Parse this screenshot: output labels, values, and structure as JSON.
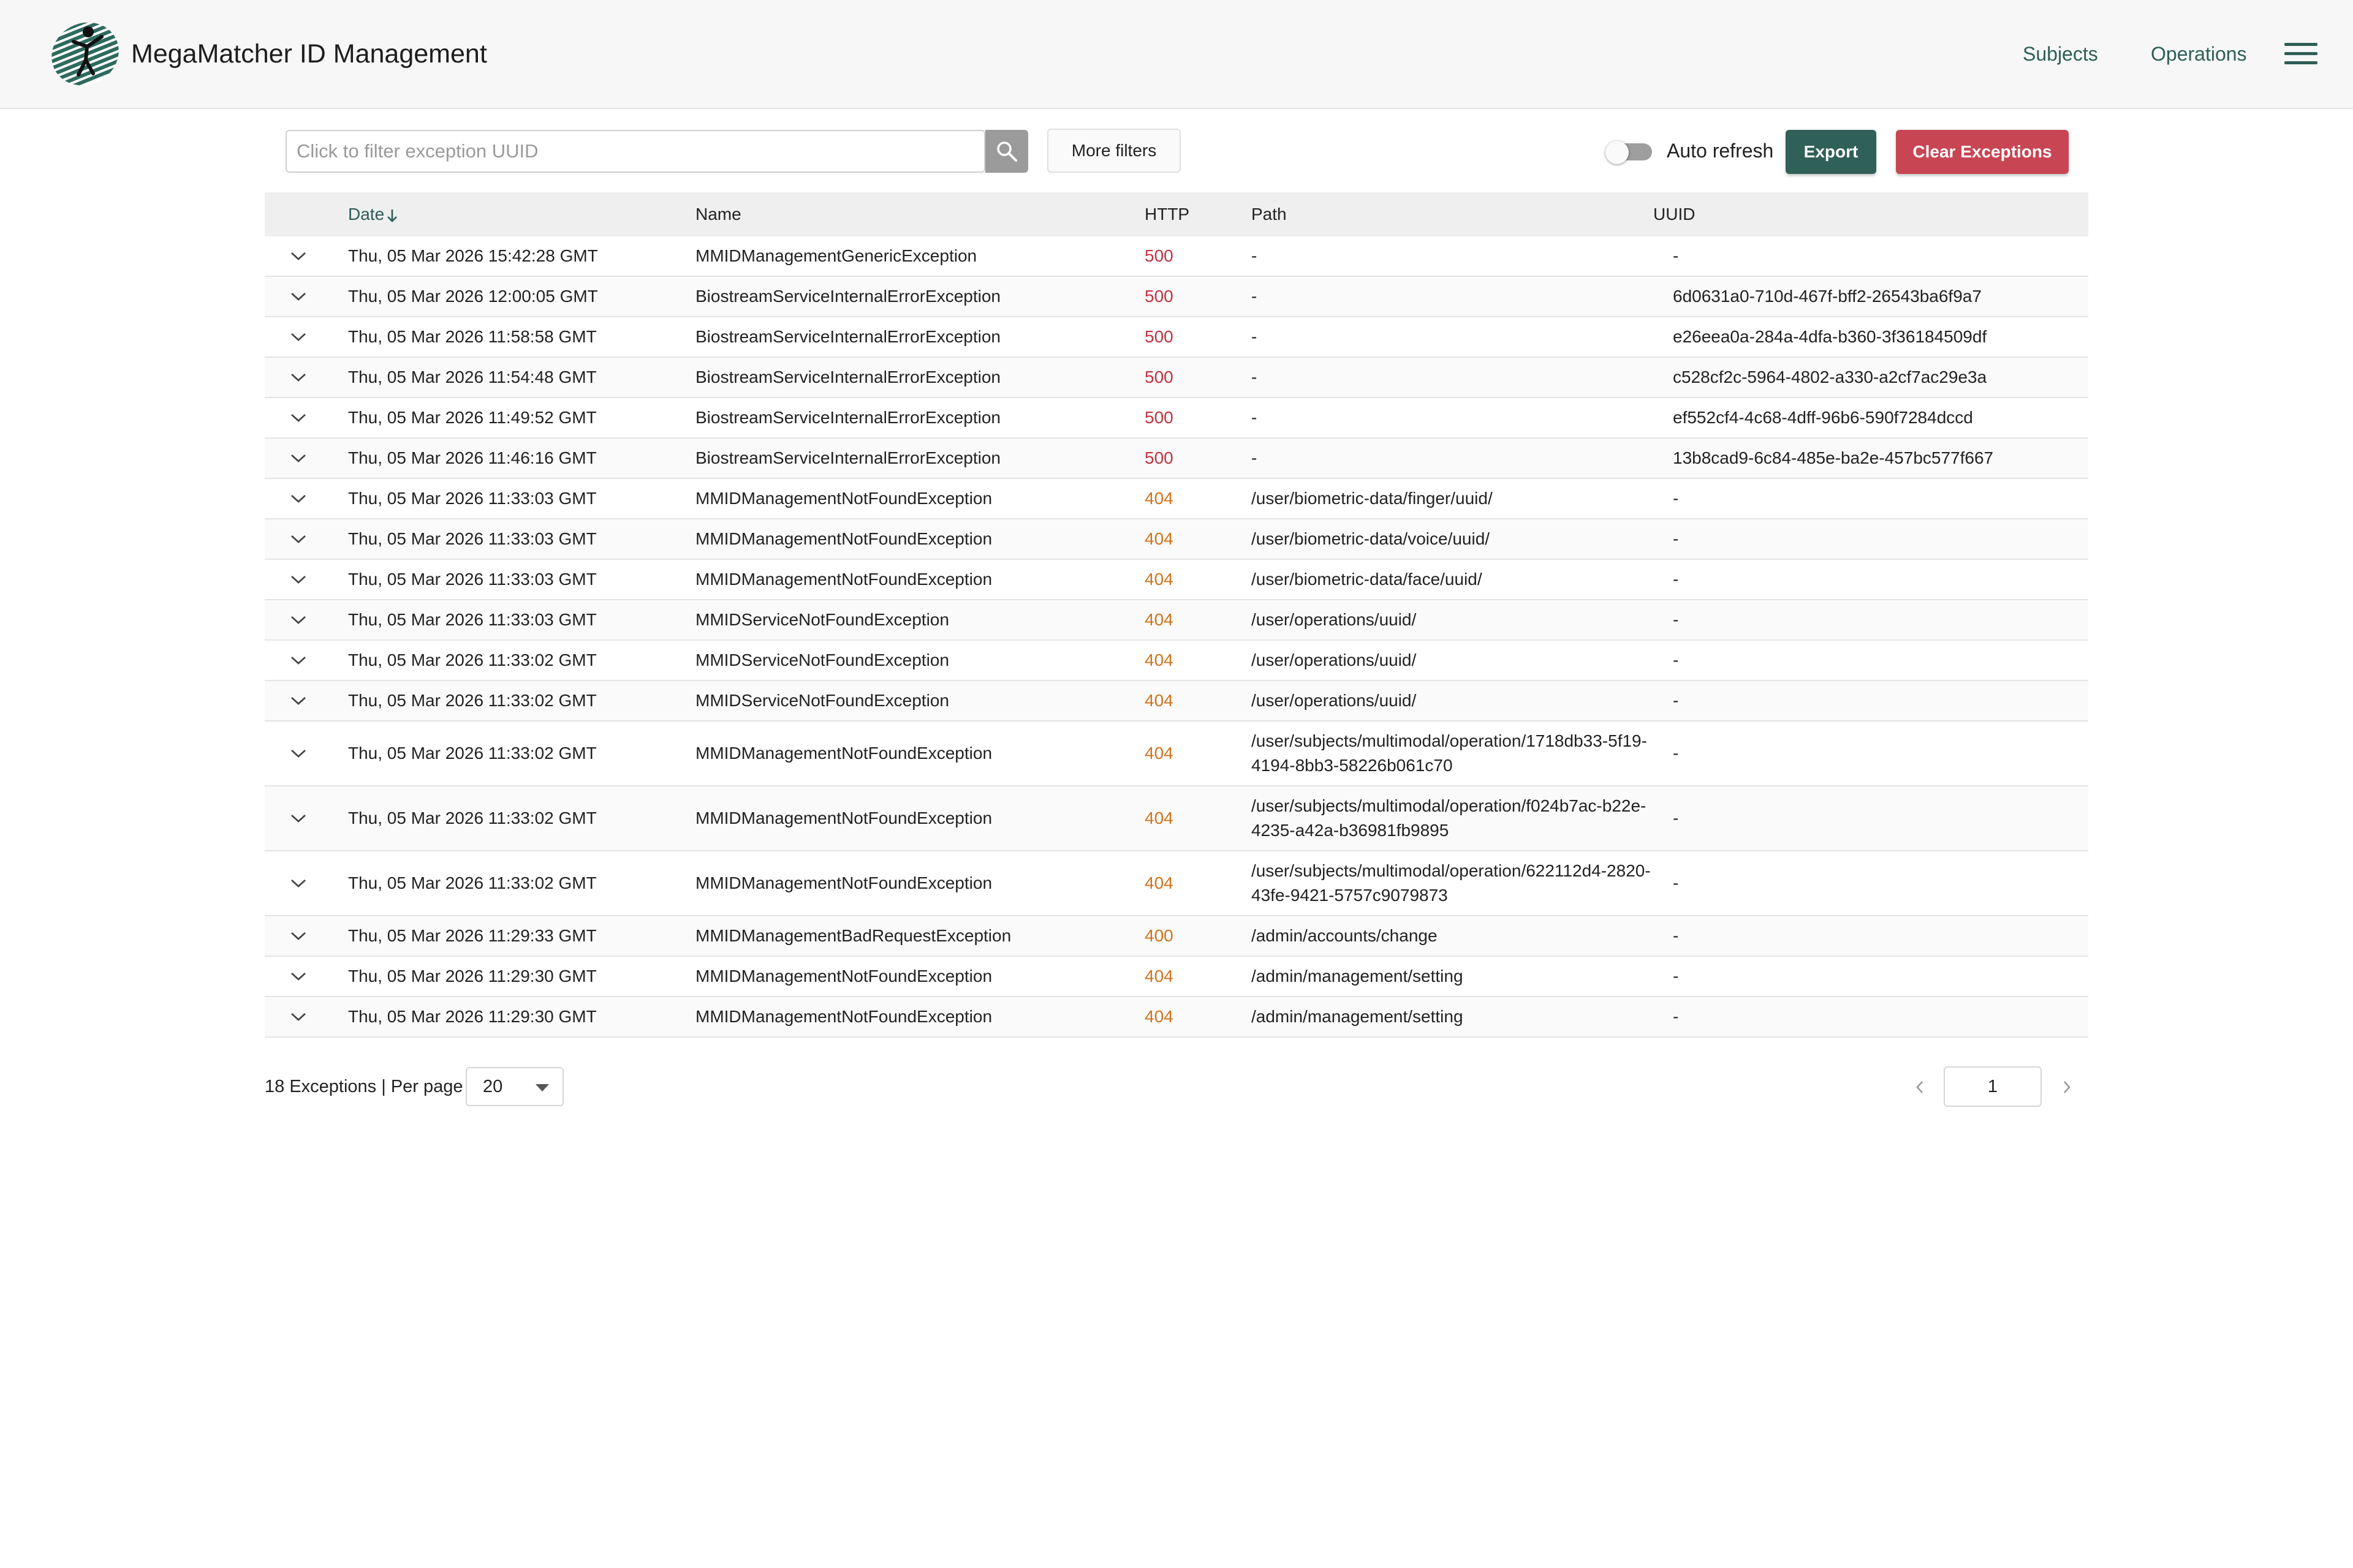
{
  "header": {
    "app_title": "MegaMatcher ID Management",
    "nav": {
      "subjects": "Subjects",
      "operations": "Operations"
    },
    "menu_icon": "hamburger-menu-icon",
    "brand_color": "#2e5e56"
  },
  "toolbar": {
    "search_placeholder": "Click to filter exception UUID",
    "search_value": "",
    "more_filters": "More filters",
    "auto_refresh": "Auto refresh",
    "auto_refresh_on": false,
    "export": "Export",
    "clear": "Clear Exceptions",
    "export_color": "#2f6158",
    "clear_color": "#c84553"
  },
  "table": {
    "headers": {
      "date": "Date",
      "name": "Name",
      "http": "HTTP",
      "path": "Path",
      "uuid": "UUID"
    },
    "sort": {
      "column": "date",
      "direction": "descending",
      "icon": "arrow-down-icon"
    },
    "rows": [
      {
        "date": "Thu, 05 Mar 2026 15:42:28 GMT",
        "name": "MMIDManagementGenericException",
        "http": "500",
        "path": "-",
        "uuid": "-"
      },
      {
        "date": "Thu, 05 Mar 2026 12:00:05 GMT",
        "name": "BiostreamServiceInternalErrorException",
        "http": "500",
        "path": "-",
        "uuid": "6d0631a0-710d-467f-bff2-26543ba6f9a7"
      },
      {
        "date": "Thu, 05 Mar 2026 11:58:58 GMT",
        "name": "BiostreamServiceInternalErrorException",
        "http": "500",
        "path": "-",
        "uuid": "e26eea0a-284a-4dfa-b360-3f36184509df"
      },
      {
        "date": "Thu, 05 Mar 2026 11:54:48 GMT",
        "name": "BiostreamServiceInternalErrorException",
        "http": "500",
        "path": "-",
        "uuid": "c528cf2c-5964-4802-a330-a2cf7ac29e3a"
      },
      {
        "date": "Thu, 05 Mar 2026 11:49:52 GMT",
        "name": "BiostreamServiceInternalErrorException",
        "http": "500",
        "path": "-",
        "uuid": "ef552cf4-4c68-4dff-96b6-590f7284dccd"
      },
      {
        "date": "Thu, 05 Mar 2026 11:46:16 GMT",
        "name": "BiostreamServiceInternalErrorException",
        "http": "500",
        "path": "-",
        "uuid": "13b8cad9-6c84-485e-ba2e-457bc577f667"
      },
      {
        "date": "Thu, 05 Mar 2026 11:33:03 GMT",
        "name": "MMIDManagementNotFoundException",
        "http": "404",
        "path": "/user/biometric-data/finger/uuid/",
        "uuid": "-"
      },
      {
        "date": "Thu, 05 Mar 2026 11:33:03 GMT",
        "name": "MMIDManagementNotFoundException",
        "http": "404",
        "path": "/user/biometric-data/voice/uuid/",
        "uuid": "-"
      },
      {
        "date": "Thu, 05 Mar 2026 11:33:03 GMT",
        "name": "MMIDManagementNotFoundException",
        "http": "404",
        "path": "/user/biometric-data/face/uuid/",
        "uuid": "-"
      },
      {
        "date": "Thu, 05 Mar 2026 11:33:03 GMT",
        "name": "MMIDServiceNotFoundException",
        "http": "404",
        "path": "/user/operations/uuid/",
        "uuid": "-"
      },
      {
        "date": "Thu, 05 Mar 2026 11:33:02 GMT",
        "name": "MMIDServiceNotFoundException",
        "http": "404",
        "path": "/user/operations/uuid/",
        "uuid": "-"
      },
      {
        "date": "Thu, 05 Mar 2026 11:33:02 GMT",
        "name": "MMIDServiceNotFoundException",
        "http": "404",
        "path": "/user/operations/uuid/",
        "uuid": "-"
      },
      {
        "date": "Thu, 05 Mar 2026 11:33:02 GMT",
        "name": "MMIDManagementNotFoundException",
        "http": "404",
        "path": "/user/subjects/multimodal/operation/1718db33-5f19-4194-8bb3-58226b061c70",
        "uuid": "-"
      },
      {
        "date": "Thu, 05 Mar 2026 11:33:02 GMT",
        "name": "MMIDManagementNotFoundException",
        "http": "404",
        "path": "/user/subjects/multimodal/operation/f024b7ac-b22e-4235-a42a-b36981fb9895",
        "uuid": "-"
      },
      {
        "date": "Thu, 05 Mar 2026 11:33:02 GMT",
        "name": "MMIDManagementNotFoundException",
        "http": "404",
        "path": "/user/subjects/multimodal/operation/622112d4-2820-43fe-9421-5757c9079873",
        "uuid": "-"
      },
      {
        "date": "Thu, 05 Mar 2026 11:29:33 GMT",
        "name": "MMIDManagementBadRequestException",
        "http": "400",
        "path": "/admin/accounts/change",
        "uuid": "-"
      },
      {
        "date": "Thu, 05 Mar 2026 11:29:30 GMT",
        "name": "MMIDManagementNotFoundException",
        "http": "404",
        "path": "/admin/management/setting",
        "uuid": "-"
      },
      {
        "date": "Thu, 05 Mar 2026 11:29:30 GMT",
        "name": "MMIDManagementNotFoundException",
        "http": "404",
        "path": "/admin/management/setting",
        "uuid": "-"
      }
    ],
    "status_colors": {
      "5xx": "#c23241",
      "4xx": "#d1731b"
    }
  },
  "footer": {
    "count_text": "18 Exceptions | Per page",
    "per_page": "20",
    "page": "1"
  }
}
